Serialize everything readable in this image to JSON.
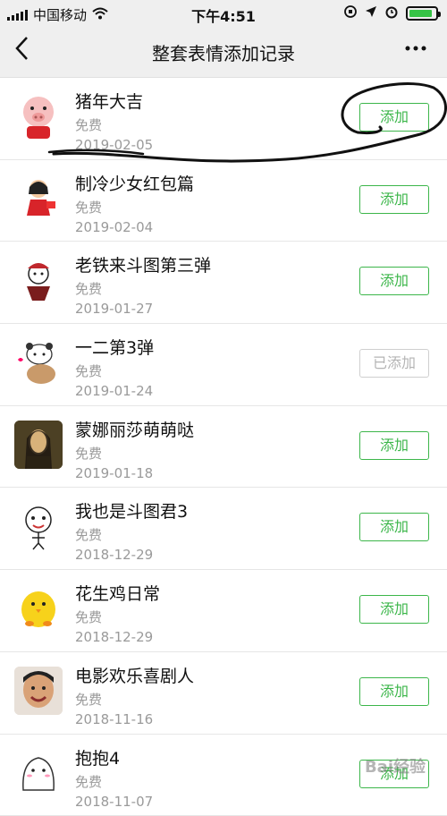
{
  "status_bar": {
    "carrier": "中国移动",
    "time": "下午4:51",
    "battery_percent": 90
  },
  "navbar": {
    "back_icon": "chevron-left-icon",
    "title": "整套表情添加记录",
    "more_icon": "more-dots-icon"
  },
  "items": [
    {
      "name": "猪年大吉",
      "price": "免费",
      "date": "2019-02-05",
      "button": "添加",
      "added": false,
      "avatar_icon": "pig-sticker",
      "avatar_color": "#f6c7c7"
    },
    {
      "name": "制冷少女红包篇",
      "price": "免费",
      "date": "2019-02-04",
      "button": "添加",
      "added": false,
      "avatar_icon": "girl-red-dress-sticker",
      "avatar_color": "#ffffff"
    },
    {
      "name": "老铁来斗图第三弹",
      "price": "免费",
      "date": "2019-01-27",
      "button": "添加",
      "added": false,
      "avatar_icon": "hat-guy-sticker",
      "avatar_color": "#ffffff"
    },
    {
      "name": "一二第3弹",
      "price": "免费",
      "date": "2019-01-24",
      "button": "已添加",
      "added": true,
      "avatar_icon": "bears-sticker",
      "avatar_color": "#ffffff"
    },
    {
      "name": "蒙娜丽莎萌萌哒",
      "price": "免费",
      "date": "2019-01-18",
      "button": "添加",
      "added": false,
      "avatar_icon": "mona-lisa-sticker",
      "avatar_color": "#5a4a2a"
    },
    {
      "name": "我也是斗图君3",
      "price": "免费",
      "date": "2018-12-29",
      "button": "添加",
      "added": false,
      "avatar_icon": "doodle-face-sticker",
      "avatar_color": "#ffffff"
    },
    {
      "name": "花生鸡日常",
      "price": "免费",
      "date": "2018-12-29",
      "button": "添加",
      "added": false,
      "avatar_icon": "yellow-chick-sticker",
      "avatar_color": "#ffffff"
    },
    {
      "name": "电影欢乐喜剧人",
      "price": "免费",
      "date": "2018-11-16",
      "button": "添加",
      "added": false,
      "avatar_icon": "comedian-face-sticker",
      "avatar_color": "#e8b48a"
    },
    {
      "name": "抱抱4",
      "price": "免费",
      "date": "2018-11-07",
      "button": "添加",
      "added": false,
      "avatar_icon": "hug-ghost-sticker",
      "avatar_color": "#ffffff"
    }
  ],
  "watermark": "Bai经验"
}
